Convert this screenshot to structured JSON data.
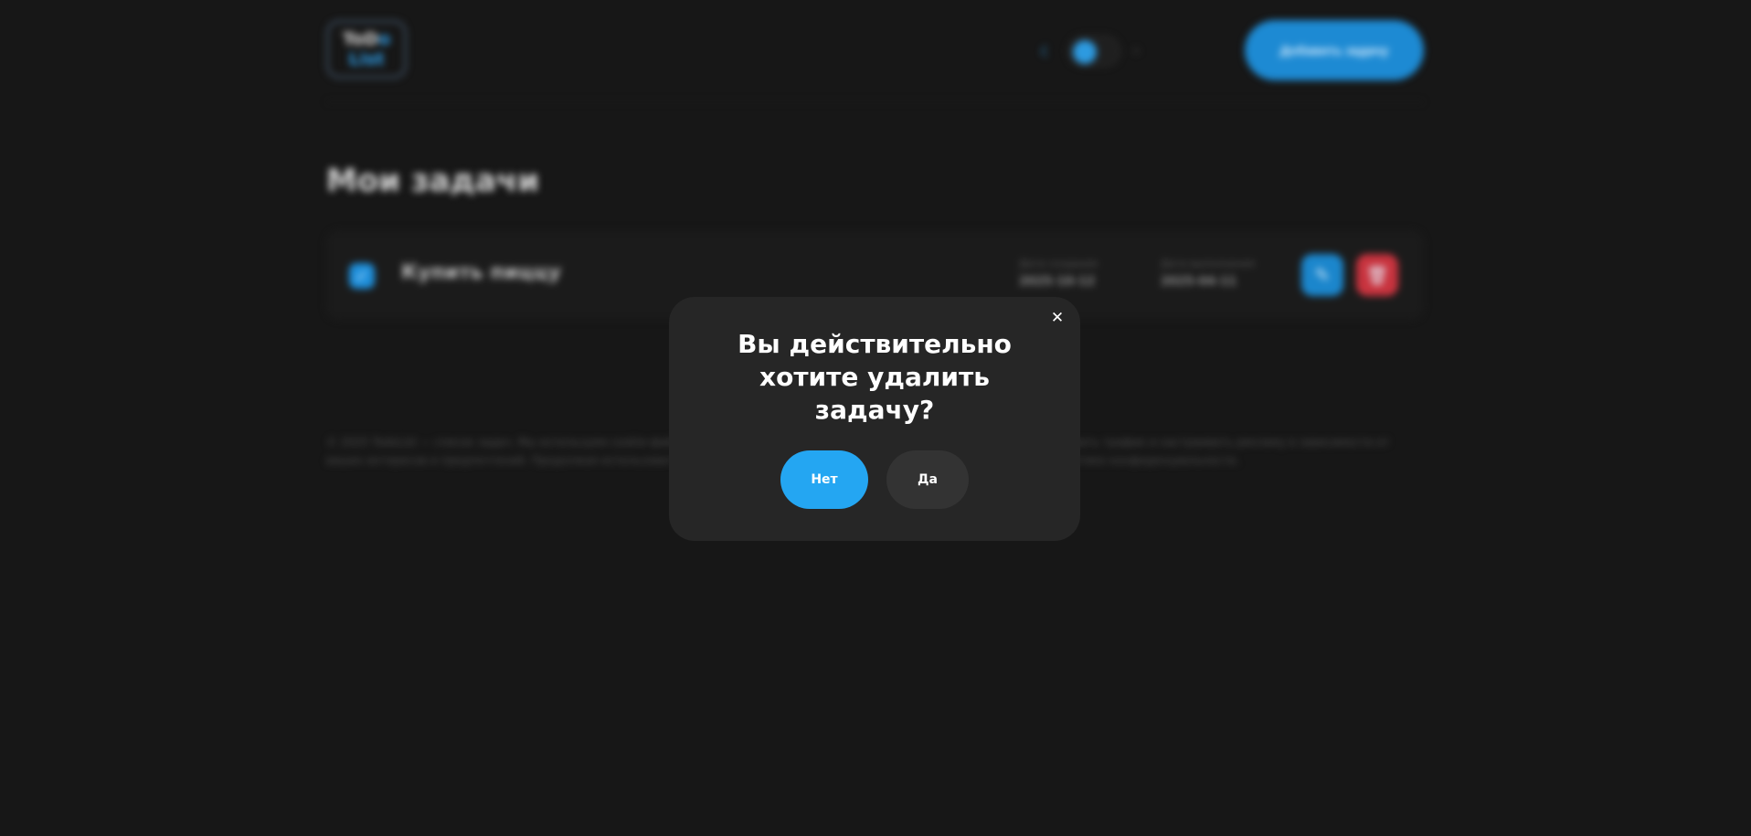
{
  "header": {
    "logo_line1_a": "ToD",
    "logo_line1_b": "o",
    "logo_line2": "List",
    "add_task_label": "Добавить задачу"
  },
  "main": {
    "title": "Мои задачи",
    "tasks": [
      {
        "title": "Купить пиццу",
        "created_label": "Дата создания",
        "created_value": "2025-10-12",
        "completed_label": "Дата выполнения",
        "completed_value": "2025-04-11",
        "done": true
      }
    ]
  },
  "footer": {
    "text": "© 2025 TodoList — список задач. Мы используем cookie-файлы, чтобы обеспечить корректную работу сайта, а также анализировать трафик и настраивать рекламу в зависимости от ваших интересов и предпочтений. Продолжая использовать сайт, вы соглашаетесь на обработку данных. Подробнее см. в политике конфиденциальности."
  },
  "modal": {
    "title": "Вы действительно хотите удалить задачу?",
    "no_label": "Нет",
    "yes_label": "Да",
    "close_glyph": "✕"
  },
  "colors": {
    "accent": "#24a6f2",
    "danger": "#c8333e",
    "background": "#171717",
    "modal_bg": "#262626"
  }
}
